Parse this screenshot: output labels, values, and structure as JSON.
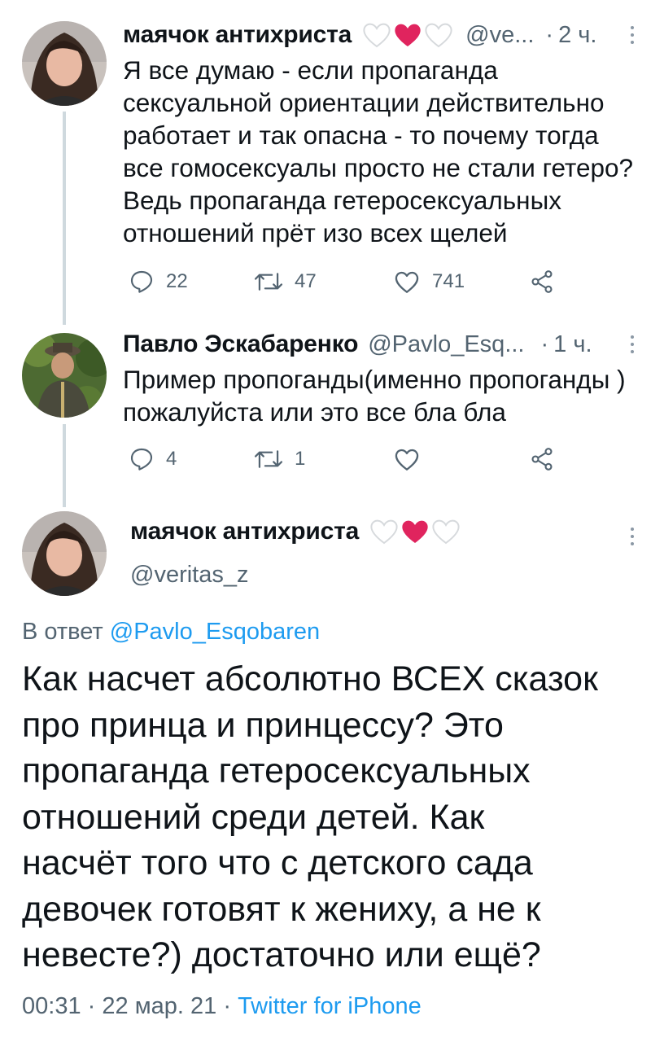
{
  "tweets": [
    {
      "display_name": "маячок антихриста",
      "handle": "@ve...",
      "sep": "·",
      "time": "2 ч.",
      "lines": [
        "Я все думаю - если пропаганда",
        "сексуальной ориентации действительно",
        "работает и так опасна - то почему тогда",
        "все гомосексуалы просто не стали гетеро?",
        "Ведь пропаганда гетеросексуальных",
        "отношений прёт изо всех щелей"
      ],
      "replies": "22",
      "retweets": "47",
      "likes": "741"
    },
    {
      "display_name": "Павло Эскабаренко",
      "handle": "@Pavlo_Esq...",
      "sep": "·",
      "time": "1 ч.",
      "lines": [
        "Пример пропоганды(именно пропоганды )",
        "пожалуйста или это все бла бла"
      ],
      "replies": "4",
      "retweets": "1",
      "likes": ""
    }
  ],
  "main": {
    "display_name": "маячок антихриста",
    "handle": "@veritas_z",
    "reply_prefix": "В ответ",
    "reply_to": "@Pavlo_Esqobaren",
    "lines": [
      "Как насчет абсолютно ВСЕХ сказок",
      "про принца и принцессу? Это",
      "пропаганда гетеросексуальных",
      "отношений среди детей. Как",
      "насчёт того что с детского сада",
      "девочек готовят к жениху, а не к",
      "невесте?) достаточно или ещё?"
    ],
    "time": "00:31",
    "sep1": "·",
    "date": "22 мар. 21",
    "sep2": "·",
    "client": "Twitter for iPhone"
  },
  "colors": {
    "text": "#0f1419",
    "secondary": "#536471",
    "link": "#1d9bf0",
    "heart_red": "#e0245e",
    "heart_white_stroke": "#d6d9dc",
    "thread_line": "#cfd9de"
  },
  "icons": [
    "reply-icon",
    "retweet-icon",
    "like-icon",
    "share-icon",
    "more-icon",
    "white-heart-emoji",
    "red-heart-emoji"
  ]
}
